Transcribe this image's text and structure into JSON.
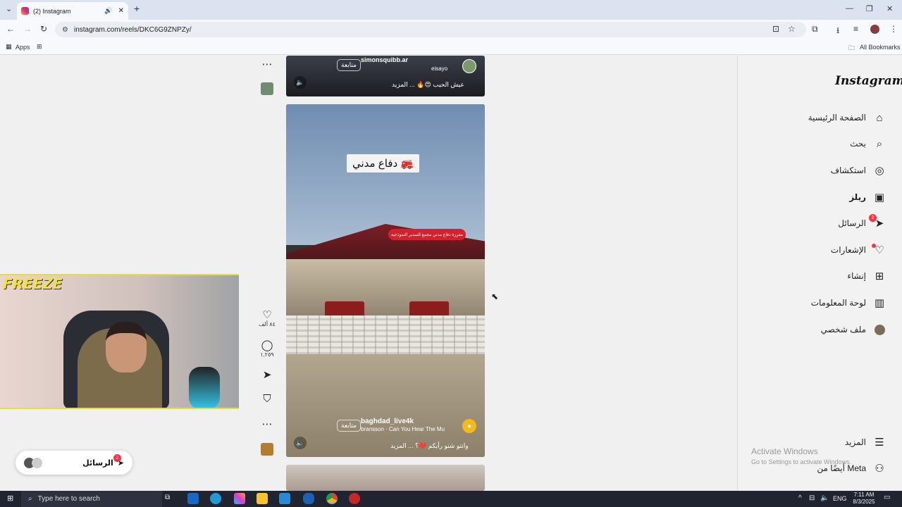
{
  "browser": {
    "tab_title": "(2) Instagram",
    "url": "instagram.com/reels/DKC6G9ZNPZy/",
    "bookmarks": {
      "apps": "Apps",
      "all_bookmarks": "All Bookmarks"
    }
  },
  "instagram": {
    "logo": "Instagram",
    "nav": [
      {
        "label": "الصفحة الرئيسية",
        "icon": "home-icon"
      },
      {
        "label": "بحث",
        "icon": "search-icon"
      },
      {
        "label": "استكشاف",
        "icon": "compass-icon"
      },
      {
        "label": "ريلز",
        "icon": "reels-icon"
      },
      {
        "label": "الرسائل",
        "icon": "send-icon",
        "badge": "2"
      },
      {
        "label": "الإشعارات",
        "icon": "heart-icon"
      },
      {
        "label": "إنشاء",
        "icon": "plus-icon"
      },
      {
        "label": "لوحة المعلومات",
        "icon": "dashboard-icon"
      },
      {
        "label": "ملف شخصي",
        "icon": "avatar-icon"
      }
    ],
    "more": "المزيد",
    "also_from_meta": "أيضًا من Meta",
    "reel_top": {
      "username": "simonsquibb.ar",
      "follow": "متابعة",
      "collab": "eisayo",
      "caption": "عيش الحيب 😍🔥 ... المزيد"
    },
    "reel_main": {
      "overlay_text": "دفاع مدني 🚒",
      "sign_text": "مفرزة دفاع مدني مجمع السدير النموذجية",
      "username": "baghdad_live4k",
      "follow": "متابعة",
      "audio": "bransson · Can You Hear The Mu",
      "caption": "وانتو شنو رأيكم ❤️؟ ... المزيد"
    },
    "actions": {
      "likes": "٨٤ ألف",
      "comments": "١,٢٥٩"
    },
    "messages_pill": {
      "label": "الرسائل",
      "badge": "2"
    }
  },
  "overlay": {
    "brand": "FREEZE"
  },
  "windows": {
    "watermark_title": "Activate Windows",
    "watermark_sub": "Go to Settings to activate Windows.",
    "search_placeholder": "Type here to search",
    "lang": "ENG",
    "time": "7:11 AM",
    "date": "8/3/2025"
  },
  "colors": {
    "accent_badge": "#ff3040",
    "taskbar": "#202431",
    "tabstrip": "#dbe3f0"
  }
}
